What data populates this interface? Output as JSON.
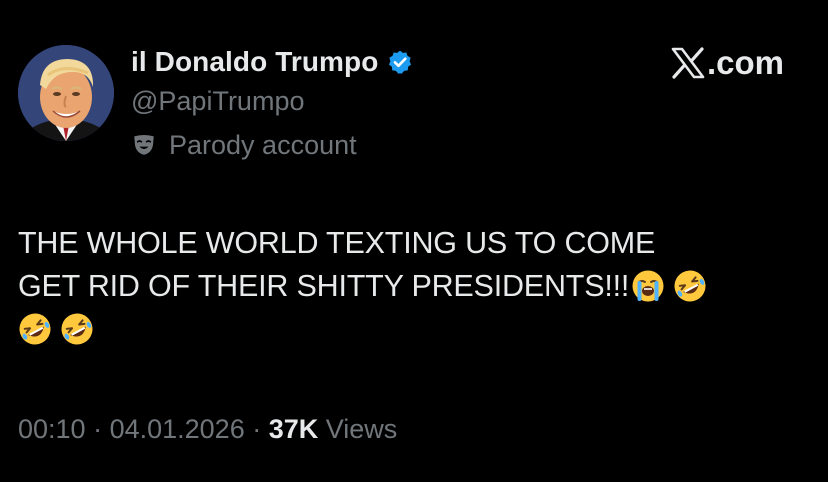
{
  "author": {
    "display_name": "il Donaldo Trumpo",
    "handle": "@PapiTrumpo",
    "verified": true,
    "label_icon": "theater-mask-icon",
    "label": "Parody account"
  },
  "brand": {
    "logo_icon": "x-logo-icon",
    "text": ".com"
  },
  "tweet": {
    "line1": "THE WHOLE WORLD TEXTING US TO COME",
    "line2": "GET RID OF THEIR SHITTY PRESIDENTS!!!",
    "emojis": [
      "loudly-crying-face",
      "rolling-on-floor-laughing",
      "rolling-on-floor-laughing",
      "rolling-on-floor-laughing"
    ]
  },
  "meta": {
    "time": "00:10",
    "separator": " · ",
    "date": "04.01.2026",
    "views_count": "37K",
    "views_label": " Views"
  },
  "colors": {
    "background": "#000000",
    "text_primary": "#e7e9ea",
    "text_secondary": "#71767b",
    "verified_badge": "#1d9bf0"
  }
}
